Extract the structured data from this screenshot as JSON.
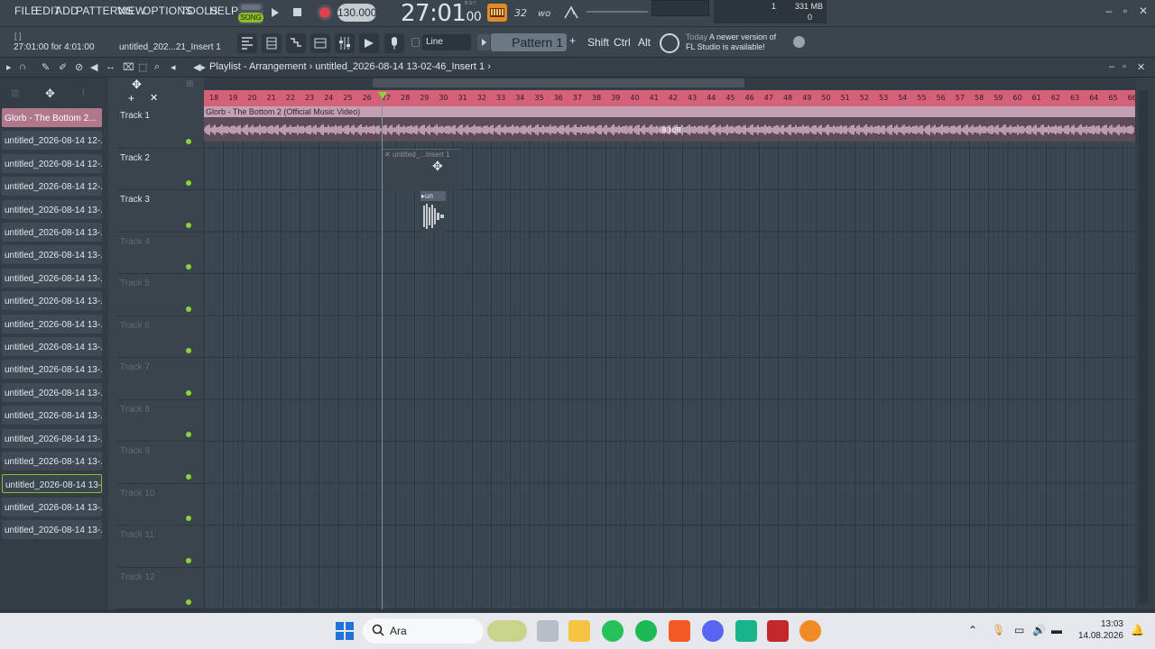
{
  "menu": [
    "FILE",
    "EDIT",
    "ADD",
    "PATTERNS",
    "VIEW",
    "OPTIONS",
    "TOOLS",
    "HELP"
  ],
  "transport": {
    "song_label": "SONG",
    "tempo": "130.000",
    "time_main": "27:01",
    "time_sub": "00",
    "time_beat": "B:S:T"
  },
  "cpu": {
    "voices": "1",
    "memory": "331 MB",
    "polyphony": "0"
  },
  "hint": {
    "line1": "[ ]",
    "time": "27:01:00 for 4:01:00",
    "file": "untitled_202...21_Insert 1"
  },
  "toolbar2": {
    "snap": "Line",
    "pattern": "Pattern 1",
    "shift": "Shift",
    "ctrl": "Ctrl",
    "alt": "Alt"
  },
  "update": {
    "day": "Today",
    "msg1": "A newer version of",
    "msg2": "FL Studio is available!"
  },
  "playlist": {
    "title": "Playlist - Arrangement",
    "sep": "›",
    "file": "untitled_2026-08-14 13-02-46_Insert 1",
    "arrow": "›"
  },
  "picker": [
    "Glorb - The Bottom 2...",
    "untitled_2026-08-14 12-...",
    "untitled_2026-08-14 12-...",
    "untitled_2026-08-14 12-...",
    "untitled_2026-08-14 13-...",
    "untitled_2026-08-14 13-...",
    "untitled_2026-08-14 13-...",
    "untitled_2026-08-14 13-...",
    "untitled_2026-08-14 13-...",
    "untitled_2026-08-14 13-...",
    "untitled_2026-08-14 13-...",
    "untitled_2026-08-14 13-...",
    "untitled_2026-08-14 13-...",
    "untitled_2026-08-14 13-...",
    "untitled_2026-08-14 13-...",
    "untitled_2026-08-14 13-...",
    "untitled_2026-08-14 13-...",
    "untitled_2026-08-14 13-...",
    "untitled_2026-08-14 13-..."
  ],
  "tracks": [
    "Track 1",
    "Track 2",
    "Track 3",
    "Track 4",
    "Track 5",
    "Track 6",
    "Track 7",
    "Track 8",
    "Track 9",
    "Track 10",
    "Track 11",
    "Track 12"
  ],
  "ruler": [
    "18",
    "19",
    "20",
    "21",
    "22",
    "23",
    "24",
    "25",
    "26",
    "27",
    "28",
    "29",
    "30",
    "31",
    "32",
    "33",
    "34",
    "35",
    "36",
    "37",
    "38",
    "39",
    "40",
    "41",
    "42",
    "43",
    "44",
    "45",
    "46",
    "47",
    "48",
    "49",
    "50",
    "51",
    "52",
    "53",
    "54",
    "55",
    "56",
    "57",
    "58",
    "59",
    "60",
    "61",
    "62",
    "63",
    "64",
    "65",
    "66"
  ],
  "clips": {
    "audio_title": "Glorb - The Bottom 2 (Official Music Video)",
    "audio_db": "-8.1dB",
    "ghost_title": "untitled_...Insert 1",
    "small_title": "un"
  },
  "taskbar": {
    "search": "Ara",
    "time": "13:03",
    "date": "14.08.2026"
  }
}
